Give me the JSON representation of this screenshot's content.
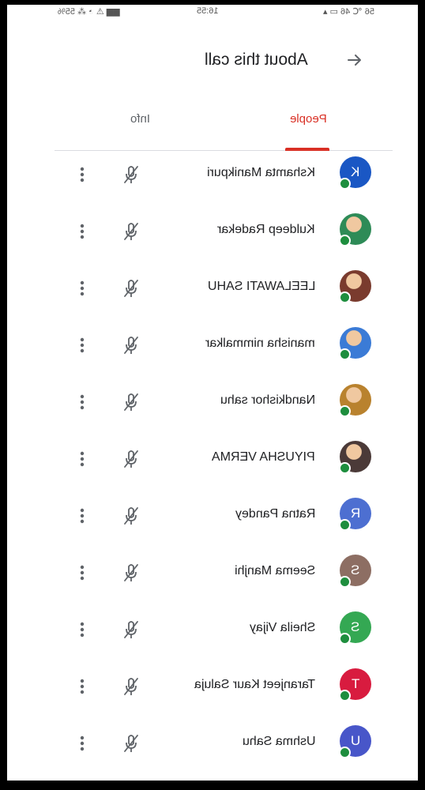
{
  "status_bar": {
    "left": "▆▆ ⚠ ◔ ⁂ 55%",
    "time": "16:55",
    "right": "56 ℃ 46 ▭ ▴"
  },
  "header": {
    "title": "About this call"
  },
  "tabs": {
    "people": "People",
    "info": "Info"
  },
  "colors": {
    "accent": "#d93025",
    "presence": "#1e8e3e"
  },
  "participants": [
    {
      "name": "Kshamta Manikpuri",
      "initial": "K",
      "avatar_color": "#1a57c4"
    },
    {
      "name": "Kuldeep Radekar",
      "initial": "",
      "avatar_color": "#2e8b57",
      "photo": true
    },
    {
      "name": "LEELAWATI SAHU",
      "initial": "",
      "avatar_color": "#7a3b2e",
      "photo": true
    },
    {
      "name": "manisha nimmalkar",
      "initial": "",
      "avatar_color": "#3b7bd6",
      "photo": true
    },
    {
      "name": "Nandkishor sahu",
      "initial": "",
      "avatar_color": "#b9822e",
      "photo": true
    },
    {
      "name": "PIYUSHA VERMA",
      "initial": "",
      "avatar_color": "#4b3a38",
      "photo": true
    },
    {
      "name": "Ratna Pandey",
      "initial": "R",
      "avatar_color": "#4d6fd1"
    },
    {
      "name": "Seema Manjhi",
      "initial": "S",
      "avatar_color": "#8d6e63"
    },
    {
      "name": "Sheila Vijay",
      "initial": "S",
      "avatar_color": "#34a853"
    },
    {
      "name": "Taranjeet Kaur Saluja",
      "initial": "T",
      "avatar_color": "#d81b3f"
    },
    {
      "name": "Ushma Sahu",
      "initial": "U",
      "avatar_color": "#4856c9"
    }
  ]
}
